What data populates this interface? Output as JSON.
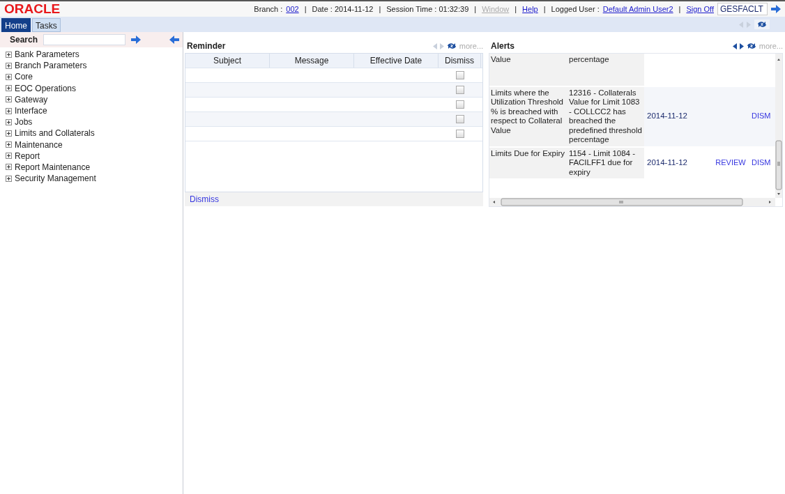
{
  "header": {
    "logo": "ORACLE",
    "separator": "|",
    "items": [
      {
        "kind": "pair",
        "label": "Branch :",
        "value": "002",
        "link": true
      },
      {
        "kind": "pair",
        "label": "Date :",
        "value": "2014-11-12",
        "link": false
      },
      {
        "kind": "pair",
        "label": "Session Time :",
        "value": "01:32:39",
        "link": false
      },
      {
        "kind": "link",
        "text": "Window",
        "disabled": true
      },
      {
        "kind": "link",
        "text": "Help",
        "disabled": false
      },
      {
        "kind": "pair",
        "label": "Logged User :",
        "value": "Default Admin User2",
        "link": true
      },
      {
        "kind": "link",
        "text": "Sign Off",
        "disabled": false
      }
    ],
    "function_field": {
      "value": "GESFACLT"
    }
  },
  "tabs": [
    {
      "label": "Home",
      "selected": true
    },
    {
      "label": "Tasks",
      "selected": false
    }
  ],
  "tab_bar_nav": {
    "disabled": true
  },
  "sidebar": {
    "search_label": "Search",
    "items": [
      {
        "label": "Bank Parameters",
        "expanded": false
      },
      {
        "label": "Branch Parameters",
        "expanded": false
      },
      {
        "label": "Core",
        "expanded": false
      },
      {
        "label": "EOC Operations",
        "expanded": false
      },
      {
        "label": "Gateway",
        "expanded": false
      },
      {
        "label": "Interface",
        "expanded": false
      },
      {
        "label": "Jobs",
        "expanded": false
      },
      {
        "label": "Limits and Collaterals",
        "expanded": false
      },
      {
        "label": "Maintenance",
        "expanded": false
      },
      {
        "label": "Report",
        "expanded": false
      },
      {
        "label": "Report Maintenance",
        "expanded": false
      },
      {
        "label": "Security Management",
        "expanded": false
      }
    ]
  },
  "reminder": {
    "title": "Reminder",
    "nav": {
      "disabled": true
    },
    "more": "more...",
    "columns": [
      "Subject",
      "Message",
      "Effective Date",
      "Dismiss"
    ],
    "rows": [
      {
        "checked": false
      },
      {
        "checked": false
      },
      {
        "checked": false
      },
      {
        "checked": false
      },
      {
        "checked": false
      }
    ],
    "footer_link": "Dismiss"
  },
  "alerts": {
    "title": "Alerts",
    "nav": {
      "disabled": false
    },
    "more": "more...",
    "rows": [
      {
        "type": "Value",
        "message": "percentage"
      },
      {
        "type": "Limits where the Utilization Threshold % is breached with respect to Collateral Value",
        "message": "12316 - Collaterals Value for Limit 1083 -  COLLCC2 has breached the predefined threshold percentage",
        "date": "2014-11-12",
        "dismiss": "DISM"
      },
      {
        "type": "Limits Due for Expiry",
        "message": "1154 - Limit 1084 - FACILFF1 due for expiry",
        "date": "2014-11-12",
        "review": "REVIEW",
        "dismiss": "DISM"
      }
    ]
  }
}
